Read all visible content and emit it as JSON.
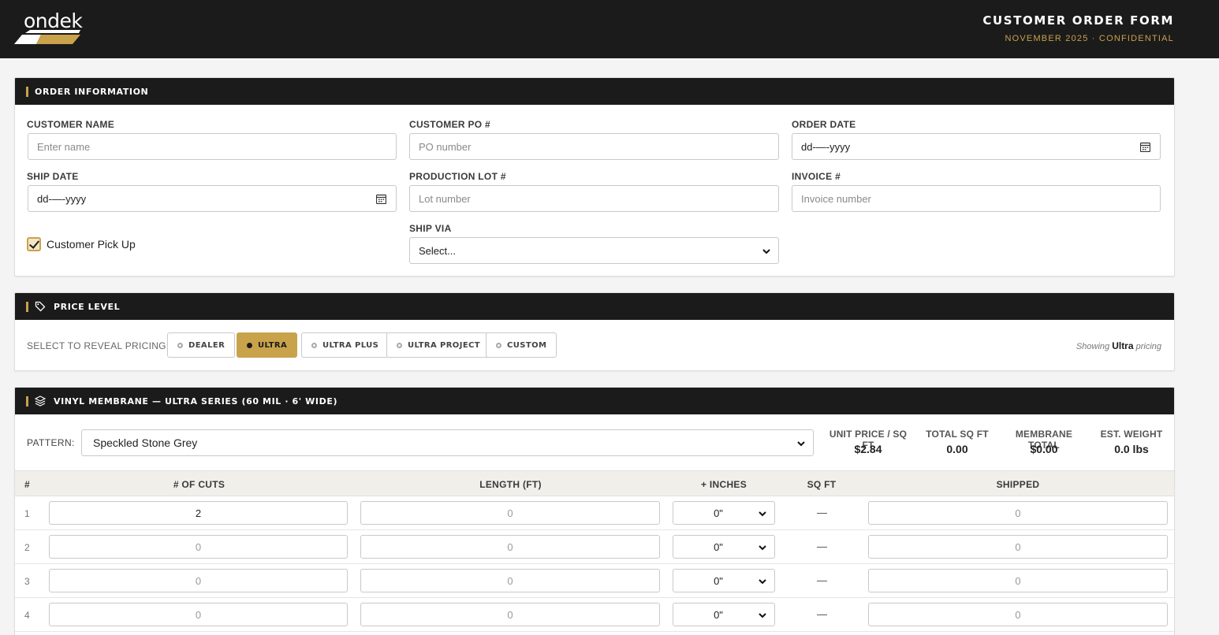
{
  "header": {
    "logo_text": "ondek",
    "title": "CUSTOMER ORDER FORM",
    "subtitle": "NOVEMBER 2025 · CONFIDENTIAL"
  },
  "order_info": {
    "heading": "ORDER INFORMATION",
    "customer_name": {
      "label": "CUSTOMER NAME",
      "placeholder": "Enter name"
    },
    "customer_po": {
      "label": "CUSTOMER PO #",
      "placeholder": "PO number"
    },
    "order_date": {
      "label": "ORDER DATE",
      "value": "dd-—-yyyy"
    },
    "ship_date": {
      "label": "SHIP DATE",
      "value": "dd-—-yyyy"
    },
    "production_lot": {
      "label": "PRODUCTION LOT #",
      "placeholder": "Lot number"
    },
    "invoice": {
      "label": "INVOICE #",
      "placeholder": "Invoice number"
    },
    "pickup": {
      "label": "Customer Pick Up",
      "checked": true
    },
    "ship_via": {
      "label": "SHIP VIA",
      "value": "Select..."
    }
  },
  "price_level": {
    "heading": "PRICE LEVEL",
    "prompt": "SELECT TO REVEAL PRICING:",
    "options": [
      "DEALER",
      "ULTRA",
      "ULTRA PLUS",
      "ULTRA PROJECT",
      "CUSTOM"
    ],
    "selected": "ULTRA",
    "showing_prefix": "Showing",
    "showing_value": "Ultra",
    "showing_suffix": "pricing"
  },
  "membrane": {
    "heading": "VINYL MEMBRANE — ULTRA SERIES (60 MIL · 6' WIDE)",
    "pattern_label": "PATTERN:",
    "pattern_value": "Speckled Stone Grey",
    "stats": [
      {
        "label": "UNIT PRICE / SQ FT",
        "value": "$2.84"
      },
      {
        "label": "TOTAL SQ FT",
        "value": "0.00"
      },
      {
        "label": "MEMBRANE TOTAL",
        "value": "$0.00"
      },
      {
        "label": "EST. WEIGHT",
        "value": "0.0 lbs"
      }
    ],
    "columns": [
      "#",
      "# OF CUTS",
      "LENGTH (FT)",
      "+ INCHES",
      "SQ FT",
      "SHIPPED"
    ],
    "rows": [
      {
        "num": "1",
        "cuts": "2",
        "length": "0",
        "inches": "0\"",
        "sqft": "—",
        "shipped": "0"
      },
      {
        "num": "2",
        "cuts": "0",
        "length": "0",
        "inches": "0\"",
        "sqft": "—",
        "shipped": "0"
      },
      {
        "num": "3",
        "cuts": "0",
        "length": "0",
        "inches": "0\"",
        "sqft": "—",
        "shipped": "0"
      },
      {
        "num": "4",
        "cuts": "0",
        "length": "0",
        "inches": "0\"",
        "sqft": "—",
        "shipped": "0"
      }
    ]
  },
  "colors": {
    "accent": "#c9a24c",
    "dark": "#1b1b1b"
  }
}
